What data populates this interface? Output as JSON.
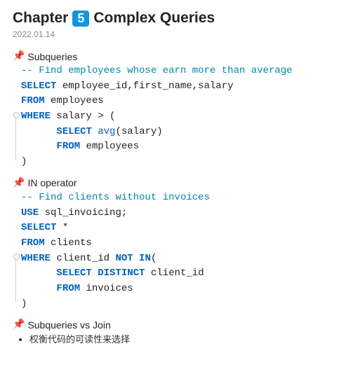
{
  "title": {
    "prefix": "Chapter",
    "badge": "5",
    "suffix": "Complex Queries"
  },
  "date": "2022.01.14",
  "sections": [
    {
      "heading": "Subqueries",
      "code_lines": [
        {
          "cls": "cm",
          "text": "-- Find employees whose earn more than average"
        },
        {
          "cls": "",
          "html": "<span class='kw'>SELECT</span> <span class='txt'>employee_id,first_name,salary</span>"
        },
        {
          "cls": "",
          "html": "<span class='kw'>FROM</span> <span class='txt'>employees</span>"
        },
        {
          "cls": "",
          "html": "<span class='kw'>WHERE</span> <span class='txt'>salary &gt; (</span>"
        },
        {
          "cls": "",
          "html": "      <span class='kw'>SELECT</span> <span class='fn'>avg</span><span class='txt'>(salary)</span>"
        },
        {
          "cls": "",
          "html": "      <span class='kw'>FROM</span> <span class='txt'>employees</span>"
        },
        {
          "cls": "txt",
          "text": ")"
        }
      ]
    },
    {
      "heading": "IN operator",
      "code_lines": [
        {
          "cls": "cm",
          "text": "-- Find clients without invoices"
        },
        {
          "cls": "",
          "html": "<span class='kw'>USE</span> <span class='txt'>sql_invoicing;</span>"
        },
        {
          "cls": "",
          "html": "<span class='kw'>SELECT</span> <span class='txt'>*</span>"
        },
        {
          "cls": "",
          "html": "<span class='kw'>FROM</span> <span class='txt'>clients</span>"
        },
        {
          "cls": "",
          "html": "<span class='kw'>WHERE</span> <span class='txt'>client_id</span> <span class='kw'>NOT IN</span><span class='txt'>(</span>"
        },
        {
          "cls": "",
          "html": "      <span class='kw'>SELECT DISTINCT</span> <span class='txt'>client_id</span>"
        },
        {
          "cls": "",
          "html": "      <span class='kw'>FROM</span> <span class='txt'>invoices</span>"
        },
        {
          "cls": "txt",
          "text": ")"
        }
      ]
    },
    {
      "heading": "Subqueries vs Join",
      "bullets": [
        "权衡代码的可读性来选择"
      ]
    }
  ]
}
